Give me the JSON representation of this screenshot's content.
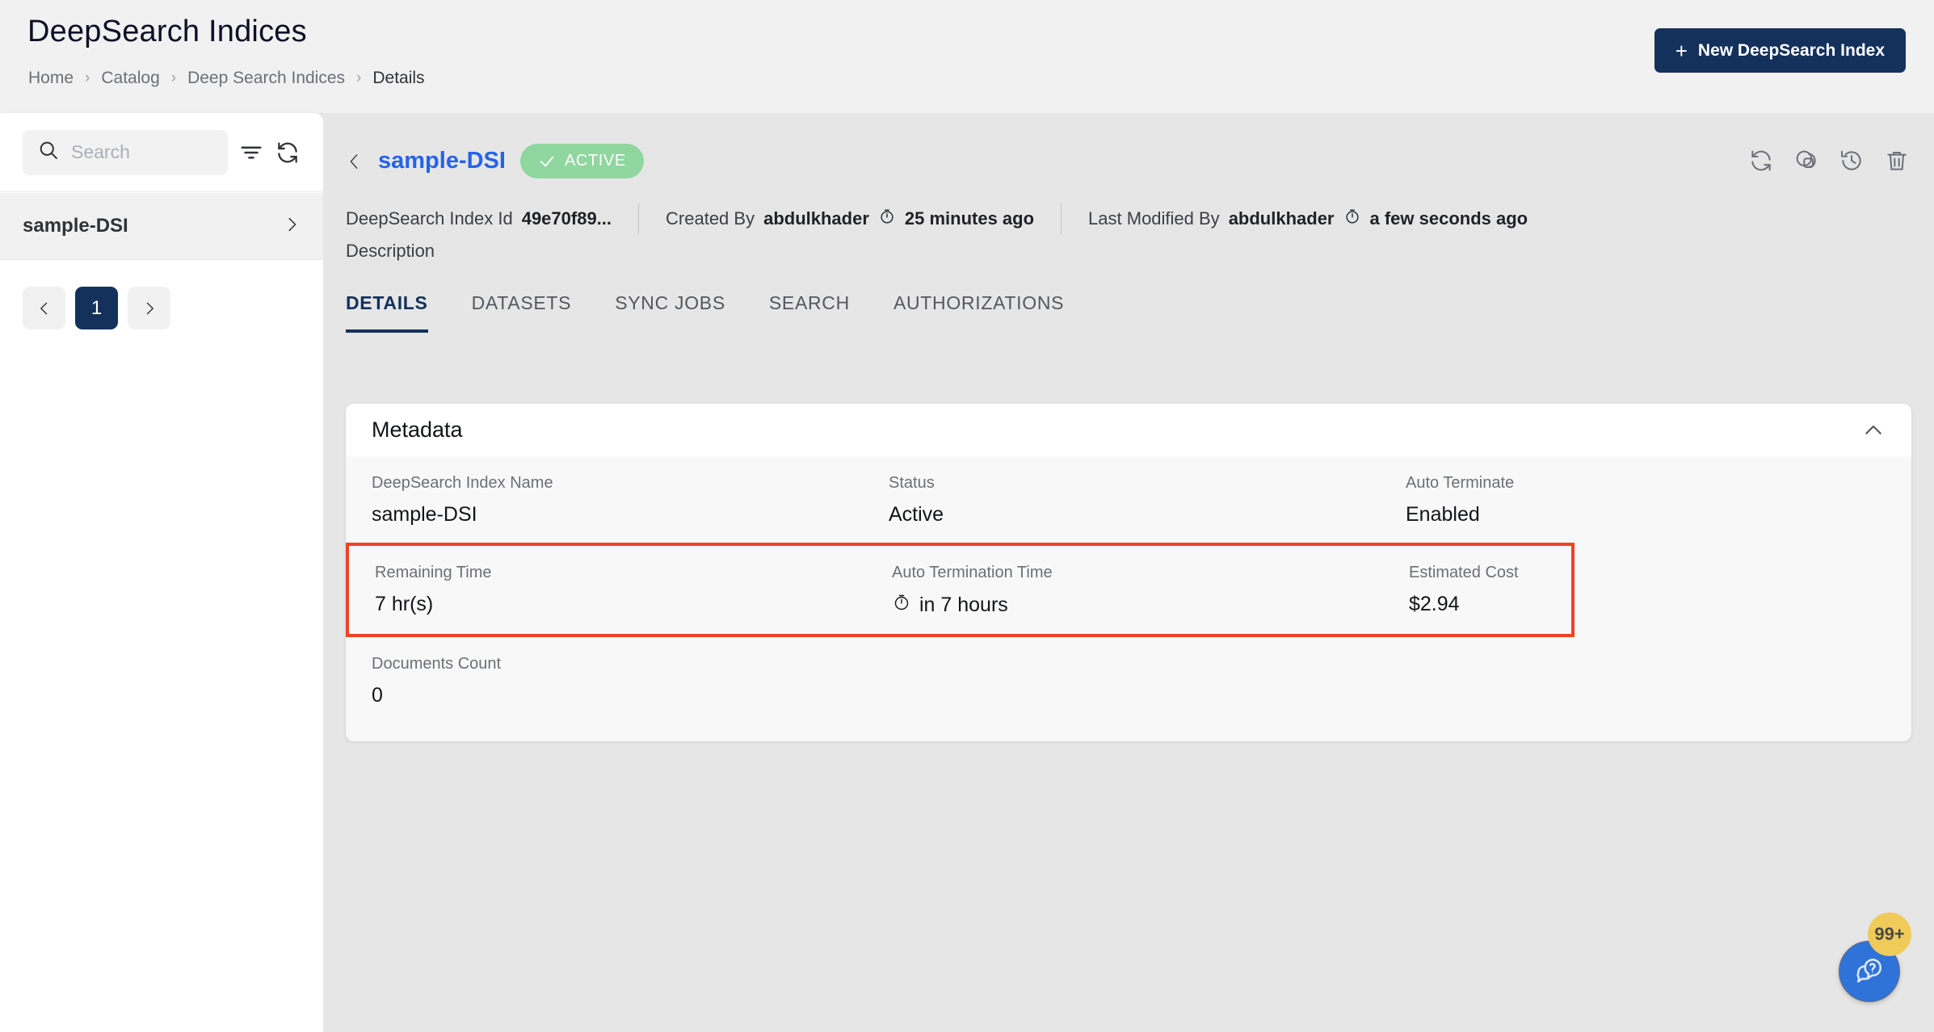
{
  "header": {
    "title": "DeepSearch Indices",
    "breadcrumb": [
      "Home",
      "Catalog",
      "Deep Search Indices",
      "Details"
    ],
    "new_index_button": "New DeepSearch Index",
    "plus": "+",
    "accent_navy": "#14315c"
  },
  "sidebar": {
    "search_placeholder": "Search",
    "search_value": "",
    "items": [
      {
        "label": "sample-DSI"
      }
    ],
    "pagination": {
      "prev": "‹",
      "current": "1",
      "next": "›"
    }
  },
  "detail": {
    "title": "sample-DSI",
    "status_badge": "ACTIVE",
    "status_color": "#8fd69f",
    "index_id_label": "DeepSearch Index Id",
    "index_id_value": "49e70f89...",
    "created_by_label": "Created By",
    "created_by_value": "abdulkhader",
    "created_time": "25 minutes ago",
    "last_modified_label": "Last Modified By",
    "last_modified_value": "abdulkhader",
    "last_modified_time": "a few seconds ago",
    "description_label": "Description"
  },
  "tabs": [
    {
      "label": "DETAILS",
      "active": true
    },
    {
      "label": "DATASETS",
      "active": false
    },
    {
      "label": "SYNC JOBS",
      "active": false
    },
    {
      "label": "SEARCH",
      "active": false
    },
    {
      "label": "AUTHORIZATIONS",
      "active": false
    }
  ],
  "metadata_card": {
    "title": "Metadata",
    "rows": [
      {
        "highlighted": false,
        "fields": [
          {
            "label": "DeepSearch Index Name",
            "value": "sample-DSI"
          },
          {
            "label": "Status",
            "value": "Active"
          },
          {
            "label": "Auto Terminate",
            "value": "Enabled"
          }
        ]
      },
      {
        "highlighted": true,
        "highlight_color": "#ef4323",
        "fields": [
          {
            "label": "Remaining Time",
            "value": "7 hr(s)"
          },
          {
            "label": "Auto Termination Time",
            "value": "in 7 hours"
          },
          {
            "label": "Estimated Cost",
            "value": "$2.94"
          }
        ]
      },
      {
        "highlighted": false,
        "fields": [
          {
            "label": "Documents Count",
            "value": "0"
          }
        ]
      }
    ]
  },
  "chat": {
    "badge_count": "99+",
    "button_color": "#2f72d8",
    "badge_color": "#f0cb5a"
  }
}
